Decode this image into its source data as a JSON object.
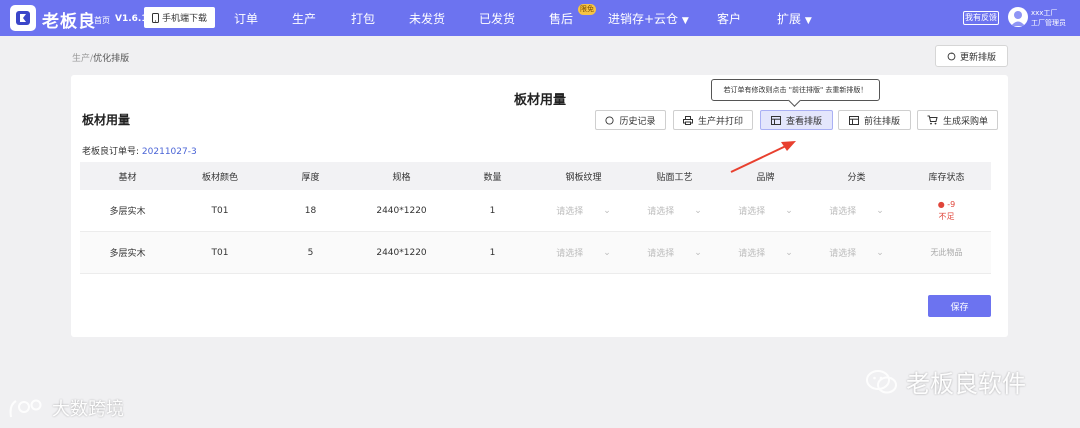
{
  "topnav": {
    "brand": "老板良",
    "home": "首页",
    "version": "V1.6.1",
    "download_label": "手机端下载",
    "items": [
      "订单",
      "生产",
      "打包",
      "未发货",
      "已发货",
      "售后",
      "进销存+云仓",
      "客户",
      "扩展"
    ],
    "hot_badge": "限免",
    "feedback": "我有反馈",
    "user_line1": "xxx工厂",
    "user_line2": "工厂管理员",
    "accent": "#6c73f0"
  },
  "breadcrumb": {
    "parent": "生产",
    "separator": "/",
    "current": "优化排版"
  },
  "refresh_label": "更新排版",
  "card": {
    "center_title": "板材用量",
    "section_title": "板材用量",
    "tooltip": "若订单有修改则点击 \"前往排版\" 去重新排版！",
    "actions": [
      "历史记录",
      "生产并打印",
      "查看排版",
      "前往排版",
      "生成采购单"
    ],
    "order_label": "老板良订单号:",
    "order_no": "20211027-3",
    "save_label": "保存"
  },
  "table": {
    "headers": [
      "基材",
      "板材颜色",
      "厚度",
      "规格",
      "数量",
      "钢板纹理",
      "贴面工艺",
      "品牌",
      "分类",
      "库存状态"
    ],
    "placeholder": "请选择",
    "rows": [
      {
        "base": "多层实木",
        "color": "T01",
        "thickness": "18",
        "spec": "2440*1220",
        "qty": "1",
        "stock_value": "● -9",
        "stock_status": "不足"
      },
      {
        "base": "多层实木",
        "color": "T01",
        "thickness": "5",
        "spec": "2440*1220",
        "qty": "1",
        "stock_value": "",
        "stock_status": "无此物品"
      }
    ]
  },
  "watermarks": {
    "right": "老板良软件",
    "left": "大数跨境"
  }
}
